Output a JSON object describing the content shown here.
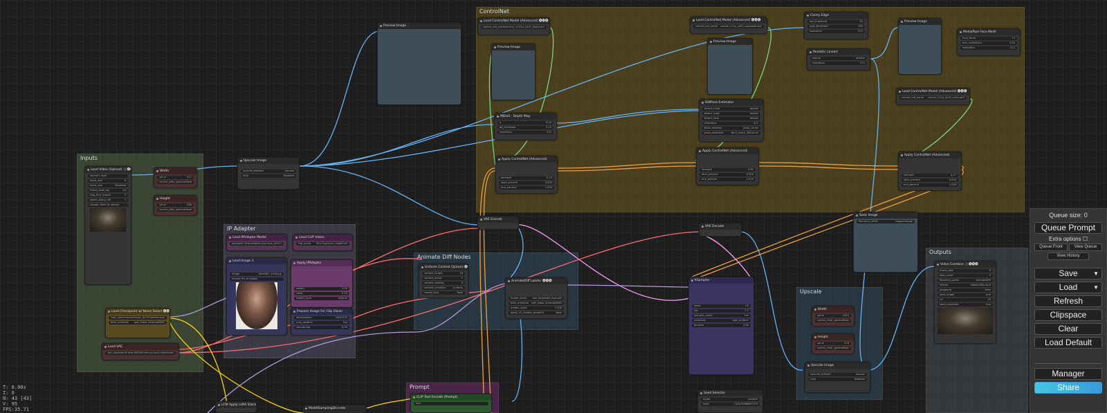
{
  "groups": {
    "controlnet": "ControlNet",
    "inputs": "Inputs",
    "ip_adapter": "IP Adapter",
    "animate_diff": "Animate Diff Nodes",
    "upscale": "Upscale",
    "outputs": "Outputs",
    "prompt": "Prompt"
  },
  "nodes": {
    "load_video": {
      "title": "Load Video (Upload) 🎥🅥🅗🅢",
      "w1": "video",
      "v1": "dancer1.mp4",
      "w2": "force_rate",
      "v2": "8",
      "w3": "force_size",
      "v3": "Disabled",
      "w4": "frame_load_cap",
      "v4": "24",
      "w5": "skip_first_frames",
      "v5": "0",
      "w6": "select_every_nth",
      "v6": "1",
      "w7": "choose video to upload"
    },
    "width": {
      "title": "Width",
      "w1": "value",
      "v1": "512",
      "w2": "control_after_generate",
      "v2": "fixed"
    },
    "height": {
      "title": "Height",
      "w1": "value",
      "v1": "288",
      "w2": "control_after_generate",
      "v2": "fixed"
    },
    "upscale_image": {
      "title": "Upscale Image",
      "w1": "upscale_method",
      "v1": "lanczos",
      "w2": "crop",
      "v2": "disabled"
    },
    "preview_image_top": {
      "title": "Preview Image"
    },
    "load_cn_depth": {
      "title": "Load ControlNet Model (Advanced) 🅐🅓🅔",
      "w1": "control_net_name",
      "v1": "control_v11f1p_sd15_depth.pth"
    },
    "preview_depth": {
      "title": "Preview Image"
    },
    "midas_depth": {
      "title": "MiDaS - Depth Map",
      "w1": "a",
      "v1": "6.28",
      "w2": "bg_threshold",
      "v2": "0.10",
      "w3": "resolution",
      "v3": "512"
    },
    "apply_cn_1": {
      "title": "Apply ControlNet (Advanced)",
      "w1": "strength",
      "v1": "0.75",
      "w2": "start_percent",
      "v2": "0.000",
      "w3": "end_percent",
      "v3": "1.000"
    },
    "load_cn_openpose": {
      "title": "Load ControlNet Model (Advanced) 🅐🅓🅔",
      "w1": "control_net_name",
      "v1": "control_v11p_sd15_openpose.pth"
    },
    "preview_pose": {
      "title": "Preview Image"
    },
    "dwpose": {
      "title": "DWPose Estimator",
      "w1": "detect_hand",
      "v1": "enable",
      "w2": "detect_body",
      "v2": "enable",
      "w3": "detect_face",
      "v3": "enable",
      "w4": "resolution",
      "v4": "512",
      "w5": "bbox_detector",
      "v5": "yolox_l.onnx",
      "w6": "pose_estimator",
      "v6": "dw-ll_ucoco_384.onnx"
    },
    "apply_cn_2": {
      "title": "Apply ControlNet (Advanced)",
      "w1": "strength",
      "v1": "0.65",
      "w2": "start_percent",
      "v2": "0.000",
      "w3": "end_percent",
      "v3": "1.000"
    },
    "canny": {
      "title": "Canny Edge",
      "w1": "low_threshold",
      "v1": "64",
      "w2": "high_threshold",
      "v2": "160",
      "w3": "resolution",
      "v3": "512"
    },
    "realistic_lineart": {
      "title": "Realistic Lineart",
      "w1": "coarse",
      "v1": "disable",
      "w2": "resolution",
      "v2": "512"
    },
    "preview_canny": {
      "title": "Preview Image"
    },
    "load_cn_canny": {
      "title": "Load ControlNet Model (Advanced) 🅐🅓🅔",
      "w1": "control_net_name",
      "v1": "control_v11p_sd15_canny.pth"
    },
    "apply_cn_3": {
      "title": "Apply ControlNet (Advanced)",
      "w1": "strength",
      "v1": "0.17",
      "w2": "start_percent",
      "v2": "0.000",
      "w3": "end_percent",
      "v3": "1.000"
    },
    "mediapipe": {
      "title": "MediaPipe Face Mesh",
      "w1": "max_faces",
      "v1": "10",
      "w2": "min_confidence",
      "v2": "0.50",
      "w3": "resolution",
      "v3": "512"
    },
    "load_ipadapter": {
      "title": "Load IPAdapter Model",
      "w1": "ipadapter_file",
      "v1": "ip-adapter-plus-face_sd15.bin"
    },
    "load_clip_vision": {
      "title": "Load CLIP Vision",
      "w1": "clip_name",
      "v1": "SD1.5\\pytorch_model.bin"
    },
    "load_image": {
      "title": "Load Image 1",
      "w1": "image",
      "v1": "a0ee067_4x16.jpg",
      "w2": "choose file to upload"
    },
    "apply_ipadapter": {
      "title": "Apply IPAdapter",
      "w1": "weight",
      "v1": "1.00",
      "w2": "noise",
      "v2": "0.33",
      "w3": "weight_type",
      "v3": "original"
    },
    "prep_clip": {
      "title": "Prepare Image For Clip Vision",
      "w1": "interpolation",
      "v1": "LANCZOS",
      "w2": "crop_position",
      "v2": "top",
      "w3": "sharpening",
      "v3": "0.00"
    },
    "checkpoint": {
      "title": "Load Checkpoint w/ Noise Select 🅐🅓🅔",
      "w1": "ckpt_name",
      "v1": "dreamshaper_8LCM.safetensors",
      "w2": "beta_schedule",
      "v2": "sqrt_linear (AnimateDiff)"
    },
    "load_vae": {
      "title": "Load VAE",
      "w1": "vae_name",
      "v1": "vae-ft-mse-840000-ema-pruned.safetensors"
    },
    "vae_encode": {
      "title": "VAE Encode"
    },
    "uniform_ctx": {
      "title": "Uniform Context Options 🅐🅓🅔",
      "w1": "context_length",
      "v1": "16",
      "w2": "context_stride",
      "v2": "1",
      "w3": "context_overlap",
      "v3": "4",
      "w4": "context_schedule",
      "v4": "uniform",
      "w5": "closed_loop",
      "v5": "false"
    },
    "animatediff_loader": {
      "title": "AnimateDiff Loader 🅐🅓🅔",
      "w1": "model_name",
      "v1": "mm-Stabilized_high.pth",
      "w2": "beta_schedule",
      "v2": "sqrt_linear (AnimateDiff)",
      "w3": "motion_scale",
      "v3": "1.000",
      "w4": "apply_v2_models_properly",
      "v4": "false"
    },
    "vae_decode": {
      "title": "VAE Decode"
    },
    "ksampler": {
      "title": "KSampler",
      "w1": "steps",
      "v1": "15",
      "w2": "cfg",
      "v2": "1.5",
      "w3": "sampler_name",
      "v3": "lcm",
      "w4": "scheduler",
      "v4": "sgm_uniform",
      "w5": "denoise",
      "v5": "1.00"
    },
    "save_image": {
      "title": "Save Image",
      "w1": "filename_prefix",
      "v1": "images/image"
    },
    "up_width": {
      "title": "Width",
      "w1": "value",
      "v1": "1024",
      "w2": "control_after_generate",
      "v2": "fixed"
    },
    "up_height": {
      "title": "Height",
      "w1": "value",
      "v1": "576",
      "w2": "control_after_generate",
      "v2": "fixed"
    },
    "up_image": {
      "title": "Upscale Image",
      "w1": "upscale_method",
      "v1": "lanczos",
      "w2": "crop",
      "v2": "disabled"
    },
    "video_combine": {
      "title": "Video Combine 🎥🅥🅗🅢",
      "w1": "frame_rate",
      "v1": "8",
      "w2": "loop_count",
      "v2": "0",
      "w3": "filename_prefix",
      "v3": "AnimateDiff",
      "w4": "format",
      "v4": "video/h264-mp4",
      "w5": "pingpong",
      "v5": "false",
      "w6": "save_image",
      "v6": "true",
      "w7": "crf",
      "v7": "20",
      "w8": "save_metadata",
      "v8": "true"
    },
    "seed": {
      "title": "Seed Selector",
      "w1": "mode",
      "v1": "random",
      "w2": "seed",
      "v2": "713470968897793"
    },
    "lora": {
      "title": "LCM Apply LoRA Stack"
    },
    "model_sampling": {
      "title": "ModelSamplingDiscrete"
    },
    "clip_text": {
      "title": "CLIP Text Encode (Prompt)",
      "w1": "text"
    }
  },
  "menu": {
    "queue_size": "Queue size: 0",
    "queue_prompt": "Queue Prompt",
    "extra_options": "Extra options",
    "queue_front": "Queue Front",
    "view_queue": "View Queue",
    "view_history": "View History",
    "save": "Save",
    "load": "Load",
    "refresh": "Refresh",
    "clipspace": "Clipspace",
    "clear": "Clear",
    "load_default": "Load Default",
    "manager": "Manager",
    "share": "Share"
  },
  "stats": {
    "t": "T: 0.00s",
    "i": "I: 0",
    "n": "N: 43 [43]",
    "v": "V: 95",
    "fps": "FPS:35.71"
  },
  "colors": {
    "controlnet_group": "#4d4020",
    "inputs_group": "#3e4a3a",
    "ipadapter_group": "#3e3b4a",
    "animatediff_group": "#2f3f4d",
    "upscale_group": "#2f3f4d",
    "outputs_group": "#3a3f45",
    "prompt_group": "#5a2f5a",
    "wire_image": "#64b5f6",
    "wire_controlnet": "#f0a040",
    "wire_latent": "#ff9cf9",
    "wire_vae": "#ff6e6e",
    "wire_clip": "#ffd500",
    "wire_model": "#b39ddb",
    "wire_cn_model": "#7bd87b"
  }
}
